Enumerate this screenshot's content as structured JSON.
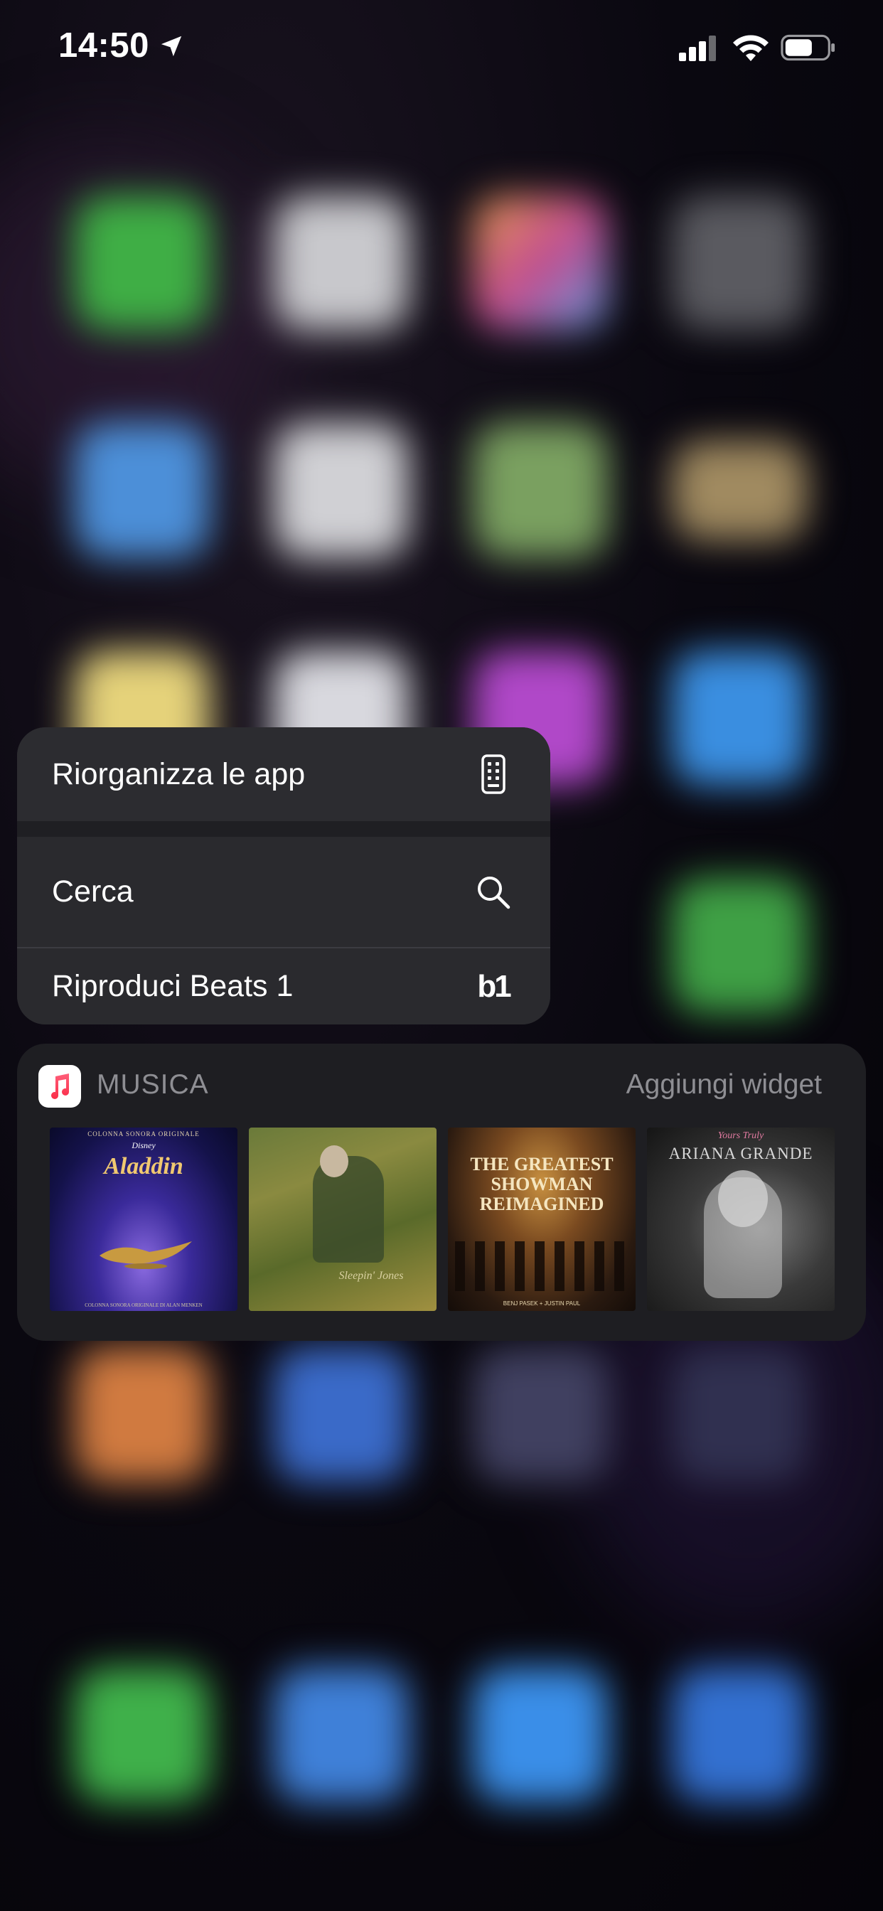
{
  "status_bar": {
    "time": "14:50"
  },
  "quick_actions": [
    {
      "label": "Riorganizza le app",
      "icon": "phone-outline-icon"
    },
    {
      "label": "Cerca",
      "icon": "search-icon"
    },
    {
      "label": "Riproduci Beats 1",
      "icon": "beats1-logo-icon",
      "icon_text": "b1"
    }
  ],
  "widget": {
    "app_name": "MUSICA",
    "add_label": "Aggiungi widget",
    "albums": [
      {
        "top_text": "COLONNA SONORA ORIGINALE",
        "brand": "Disney",
        "title": "Aladdin",
        "footer": "COLONNA SONORA ORIGINALE DI ALAN MENKEN"
      },
      {
        "title": "Sleepin' Jones"
      },
      {
        "title": "THE GREATEST SHOWMAN REIMAGINED",
        "footer": "BENJ PASEK + JUSTIN PAUL"
      },
      {
        "script": "Yours Truly",
        "title": "ARIANA GRANDE"
      }
    ]
  },
  "colors": {
    "menu_bg": "#2a2a2e",
    "widget_bg": "#1e1e22",
    "secondary_text": "#8e8e93"
  }
}
